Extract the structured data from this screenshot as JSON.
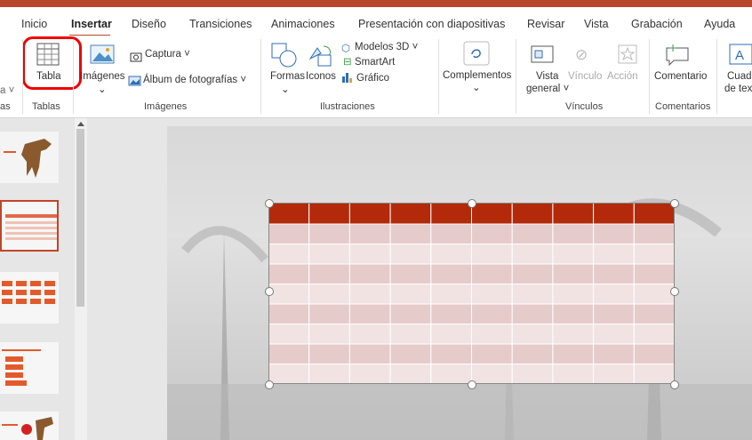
{
  "tabs": [
    "Inicio",
    "Insertar",
    "Diseño",
    "Transiciones",
    "Animaciones",
    "Presentación con diapositivas",
    "Revisar",
    "Vista",
    "Grabación",
    "Ayuda"
  ],
  "ribbon": {
    "tabla": "Tabla",
    "imagenes": "Imágenes",
    "captura": "Captura",
    "album": "Álbum de fotografías",
    "formas": "Formas",
    "iconos": "Iconos",
    "modelos3d": "Modelos 3D",
    "smartart": "SmartArt",
    "grafico": "Gráfico",
    "complementos": "Complementos",
    "vista_general": "Vista",
    "vista_general2": "general",
    "vinculo": "Vínculo",
    "accion": "Acción",
    "comentario": "Comentario",
    "cuadro": "Cuadr",
    "cuadro2": "de tex"
  },
  "groups": {
    "diapositivas_partial": "as",
    "tablas": "Tablas",
    "imagenes": "Imágenes",
    "ilustraciones": "Ilustraciones",
    "vinculos": "Vínculos",
    "comentarios": "Comentarios"
  },
  "table": {
    "columns": 10,
    "rows": 8,
    "header_color": "#b22a0a",
    "band_dark": "#e6cbcb",
    "band_light": "#f2e3e3"
  },
  "colors": {
    "accent": "#b7472a",
    "highlight": "#e00000"
  }
}
